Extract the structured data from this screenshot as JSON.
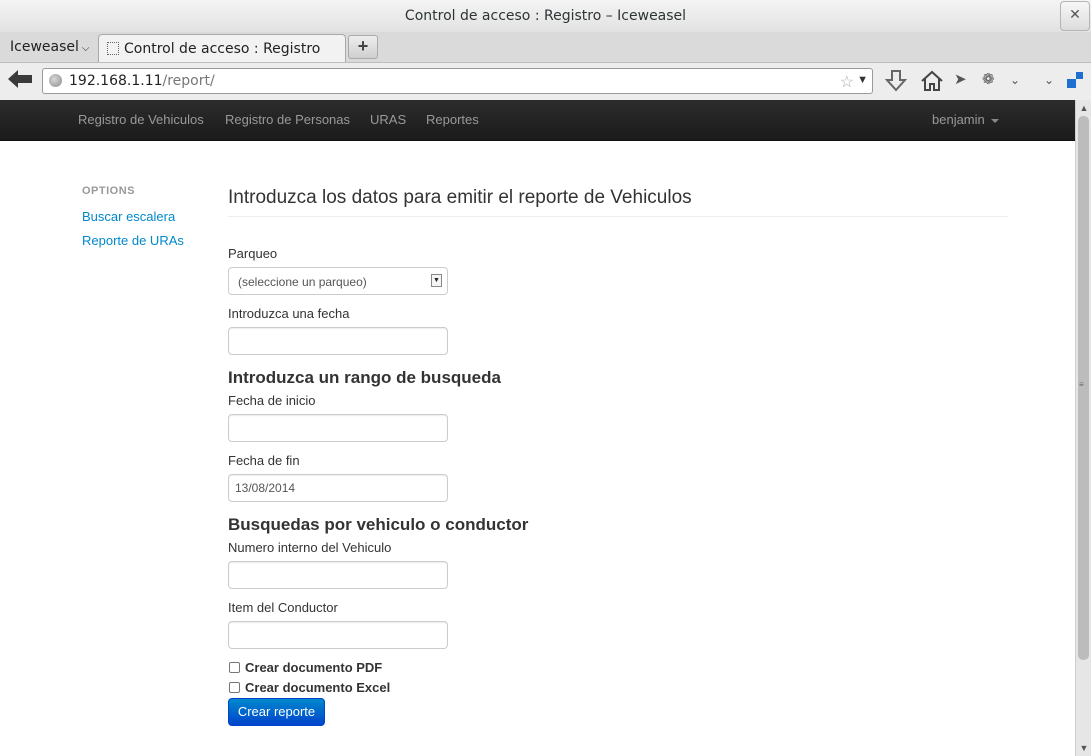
{
  "window": {
    "title": "Control de acceso : Registro – Iceweasel",
    "close_glyph": "✕"
  },
  "browser": {
    "app_menu_label": "Iceweasel",
    "tab_title": "Control de acceso : Registro",
    "new_tab_glyph": "+",
    "url_host": "192.168.1.11",
    "url_path": "/report/",
    "icons": [
      "back-arrow-icon",
      "globe-icon",
      "bookmark-star-icon",
      "download-icon",
      "home-icon",
      "send-icon",
      "bug-icon",
      "chevron-down-icon",
      "menu-chevron-icon",
      "extension-icon"
    ]
  },
  "site_nav": {
    "items": [
      "Registro de Vehiculos",
      "Registro de Personas",
      "URAS",
      "Reportes"
    ],
    "user": "benjamin"
  },
  "sidebar": {
    "header": "OPTIONS",
    "links": [
      "Buscar escalera",
      "Reporte de URAs"
    ]
  },
  "main": {
    "heading": "Introduzca los datos para emitir el reporte de Vehiculos",
    "parqueo_label": "Parqueo",
    "parqueo_selected": "(seleccione un parqueo)",
    "fecha_label": "Introduzca una fecha",
    "fecha_value": "",
    "rango_title": "Introduzca un rango de busqueda",
    "inicio_label": "Fecha de inicio",
    "inicio_value": "",
    "fin_label": "Fecha de fin",
    "fin_value": "13/08/2014",
    "busquedas_title": "Busquedas por vehiculo o conductor",
    "numero_label": "Numero interno del Vehiculo",
    "numero_value": "",
    "item_label": "Item del Conductor",
    "item_value": "",
    "pdf_label": "Crear documento PDF",
    "pdf_checked": false,
    "excel_label": "Crear documento Excel",
    "excel_checked": false,
    "submit_label": "Crear reporte"
  },
  "colors": {
    "link": "#0088cc",
    "navbar": "#1b1b1b",
    "primary_button": "#0044cc"
  }
}
